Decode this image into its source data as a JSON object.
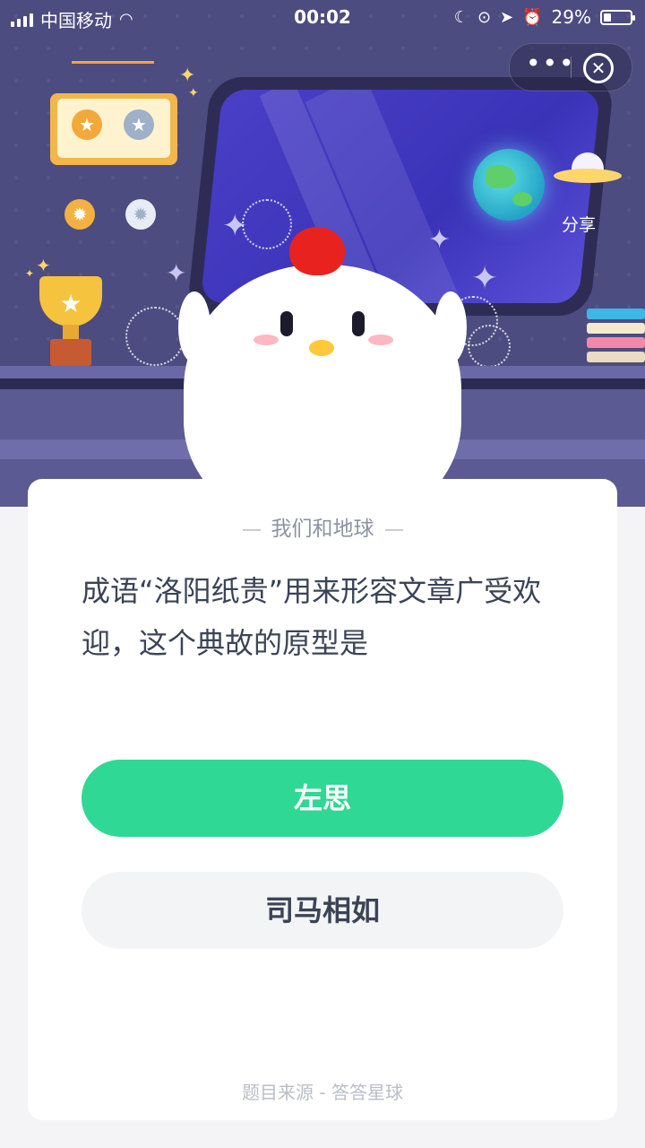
{
  "status_bar": {
    "carrier": "中国移动",
    "time": "00:02",
    "battery": "29%",
    "battery_level": 0.29
  },
  "header": {
    "share_label": "分享",
    "more_icon": "ellipsis-icon",
    "close_icon": "close-circle-icon"
  },
  "quiz": {
    "category": "我们和地球",
    "question": "成语“洛阳纸贵”用来形容文章广受欢迎，这个典故的原型是",
    "options": [
      {
        "label": "左思",
        "state": "correct"
      },
      {
        "label": "司马相如",
        "state": "default"
      }
    ],
    "source": "题目来源 - 答答星球"
  },
  "colors": {
    "scene_bg": "#4d4c80",
    "accent_green": "#2fd894",
    "option_gray": "#f3f4f6",
    "text_dark": "#3b4456"
  }
}
